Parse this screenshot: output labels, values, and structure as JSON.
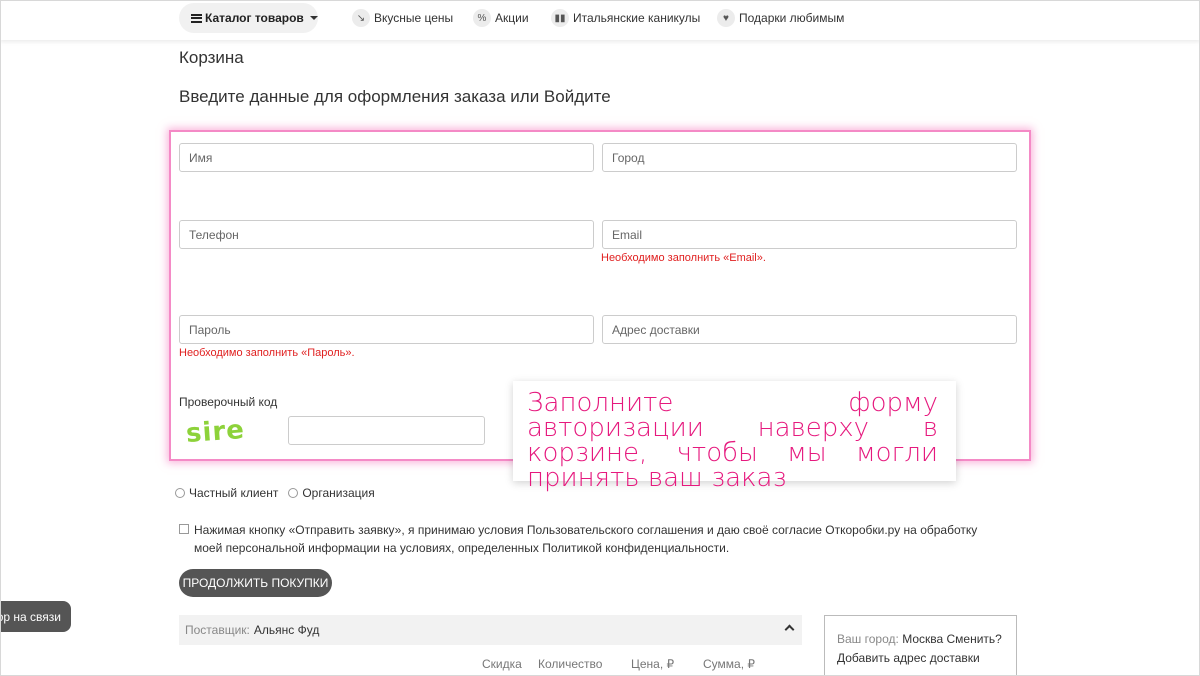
{
  "nav": {
    "catalog_label": "Каталог товаров",
    "links": [
      {
        "label": "Вкусные цены",
        "icon": "price-tag-icon"
      },
      {
        "label": "Акции",
        "icon": "percent-icon"
      },
      {
        "label": "Итальянские каникулы",
        "icon": "italy-flag-icon"
      },
      {
        "label": "Подарки любимым",
        "icon": "heart-icon"
      }
    ]
  },
  "page": {
    "cart_title": "Корзина",
    "form_title": "Введите данные для оформления заказа или Войдите"
  },
  "form": {
    "name_placeholder": "Имя",
    "city_placeholder": "Город",
    "phone_placeholder": "Телефон",
    "email_placeholder": "Email",
    "email_error": "Необходимо заполнить «Email».",
    "password_placeholder": "Пароль",
    "password_error": "Необходимо заполнить «Пароль».",
    "address_placeholder": "Адрес доставки",
    "captcha_label": "Проверочный код",
    "captcha_text": "sire"
  },
  "tooltip": {
    "text": "Заполните форму авторизации наверху в корзине, чтобы мы могли принять ваш заказ"
  },
  "customer_type": {
    "options": [
      "Частный клиент",
      "Организация"
    ]
  },
  "consent": {
    "text": "Нажимая кнопку «Отправить заявку», я принимаю условия Пользовательского соглашения и даю своё согласие Откоробки.ру на обработку моей персональной информации на условиях, определенных Политикой конфиденциальности."
  },
  "buttons": {
    "continue": "Продолжить покупки",
    "chat": "ор на связи"
  },
  "order": {
    "supplier_label": "Поставщик:",
    "supplier_name": "Альянс Фуд",
    "columns": [
      "Скидка",
      "Количество",
      "Цена, ₽",
      "Сумма, ₽"
    ]
  },
  "city_box": {
    "label": "Ваш город:",
    "city": "Москва",
    "change": "Сменить?",
    "add_address": "Добавить адрес доставки"
  },
  "colors": {
    "accent_pink": "#e6197e",
    "error_red": "#e02020",
    "button_dark": "#555555"
  }
}
